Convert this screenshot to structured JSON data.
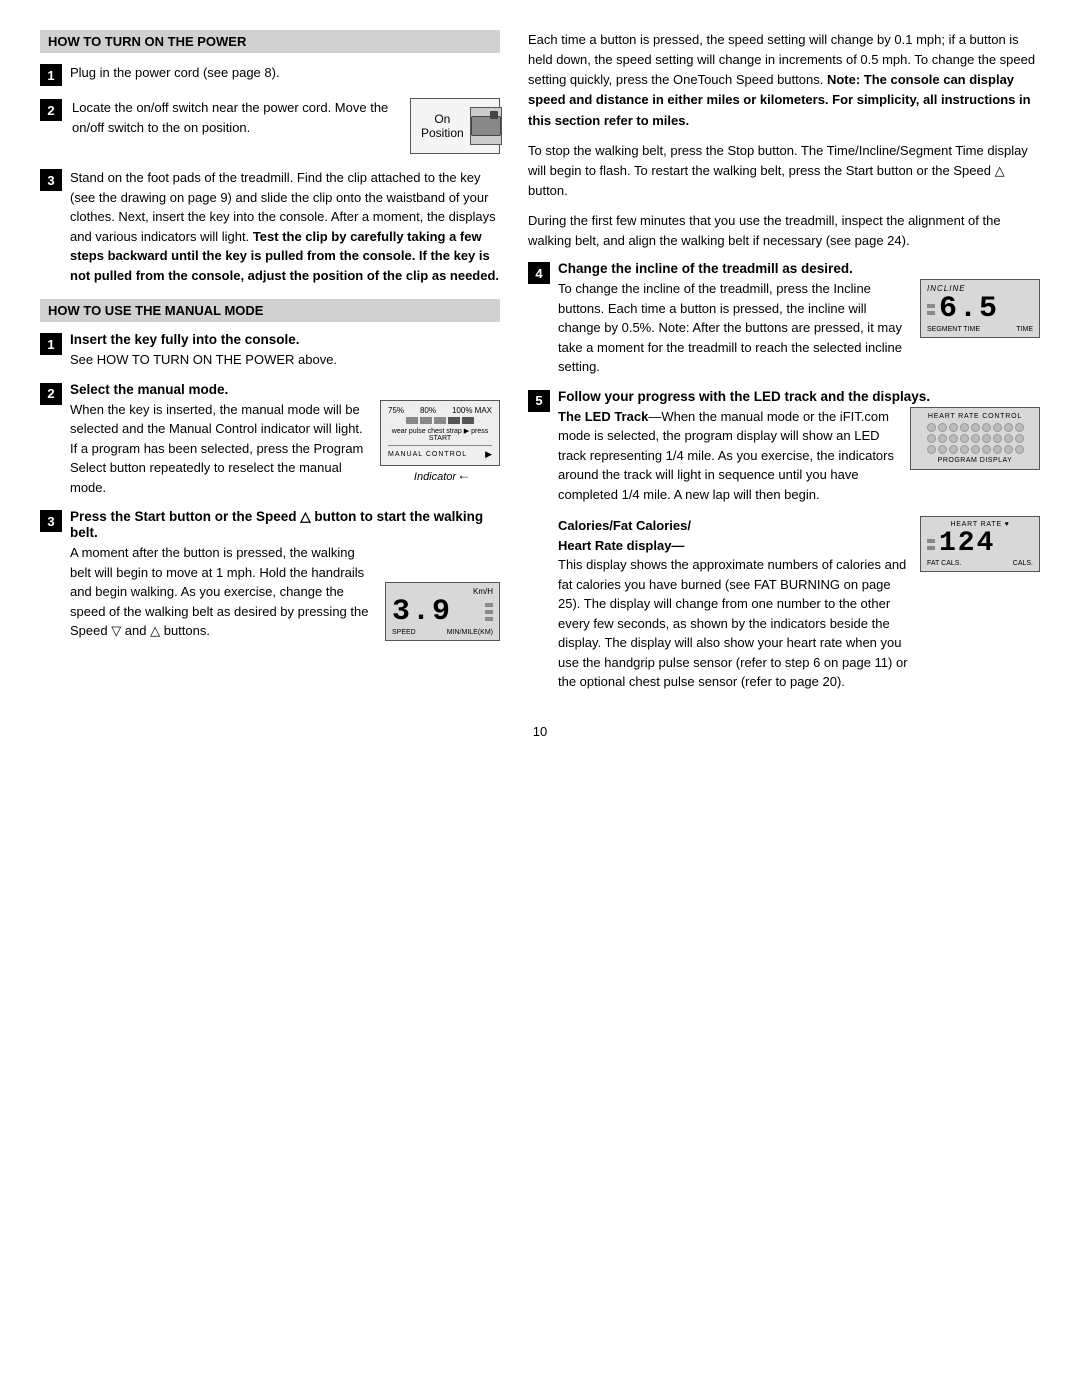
{
  "left": {
    "section1_header": "HOW TO TURN ON THE POWER",
    "step1_title": "Plug in the power cord (see page 8).",
    "step2_title": "Locate the on/off switch near the power cord. Move the on/off switch to the on position.",
    "on_position_label": "On\nPosition",
    "step3_text": "Stand on the foot pads of the treadmill. Find the clip attached to the key (see the drawing on page 9) and slide the clip onto the waistband of your clothes. Next, insert the key into the console. After a moment, the displays and various indicators will light.",
    "step3_bold": "Test the clip by carefully taking a few steps backward until the key is pulled from the console. If the key is not pulled from the console, adjust the position of the clip as needed.",
    "section2_header": "HOW TO USE THE MANUAL MODE",
    "manual_step1_title": "Insert the key fully into the console.",
    "manual_step1_text": "See HOW TO TURN ON THE POWER above.",
    "manual_step2_title": "Select the manual mode.",
    "manual_step2_text1": "When the key is inserted, the manual mode will be selected and the Manual Control indicator will light. If a program has been selected, press the Program Select button repeatedly to reselect the manual mode.",
    "manual_control_label": "MANUAL CONTROL",
    "indicator_label": "Indicator",
    "manual_step3_title": "Press the Start button or the Speed △ button to start the walking belt.",
    "manual_step3_text1": "A moment after the button is pressed, the walking belt will begin to move at 1 mph. Hold the handrails and begin walking. As you exercise, change the speed of the walking belt as desired by pressing the Speed ▽ and △ buttons.",
    "speed_display_value": "3.9",
    "speed_display_kmh": "Km/H",
    "speed_display_speed": "SPEED",
    "speed_display_min": "MIN/MILE(km)",
    "speed_change_note": "Each time a button is pressed, the speed setting will change by 0.1 mph; if a button is held down, the speed setting will change in increments of 0.5 mph. To change the speed setting quickly, press the OneTouch Speed buttons.",
    "speed_note_bold": "Note: The console can display speed and distance in either miles or kilometers. For simplicity, all instructions in this section refer to miles."
  },
  "right": {
    "para1": "Each time a button is pressed, the speed setting will change by 0.1 mph; if a button is held down, the speed setting will change in increments of 0.5 mph. To change the speed setting quickly, press the OneTouch Speed buttons.",
    "para1_bold_prefix": "Note: The console can display speed and distance in either miles or kilometers. For simplicity, all instructions in this section refer to miles.",
    "para2": "To stop the walking belt, press the Stop button. The Time/Incline/Segment Time display will begin to flash. To restart the walking belt, press the Start button or the Speed △ button.",
    "para3": "During the first few minutes that you use the treadmill, inspect the alignment of the walking belt, and align the walking belt if necessary (see page 24).",
    "step4_title": "Change the incline of the treadmill as desired.",
    "step4_text": "To change the incline of the treadmill, press the Incline buttons. Each time a button is pressed, the incline will change by 0.5%. Note: After the buttons are pressed, it may take a moment for the treadmill to reach the selected incline setting.",
    "incline_label": "INCLINE",
    "incline_value": "6.5",
    "incline_seg_label": "SEGMENT TIME",
    "incline_time_label": "TIME",
    "step5_title": "Follow your progress with the LED track and the displays.",
    "led_track_title": "The LED Track",
    "led_track_text": "—When the manual mode or the iFIT.com mode is selected, the program display will show an LED track representing 1/4 mile. As you exercise, the indicators around the track will light in sequence until you have completed 1/4 mile. A new lap will then begin.",
    "heart_rate_title": "HEART RATE CONTROL",
    "program_display_title": "PROGRAM DISPLAY",
    "calories_title": "Calories/Fat Calories/\nHeart Rate display—",
    "calories_text": "This display shows the approximate numbers of calories and fat calories you have burned (see FAT BURNING on page 25). The display will change from one number to the other every few seconds, as shown by the indicators beside the display. The display will also show your heart rate when you use the handgrip pulse sensor (refer to step 6 on page 11) or the optional chest pulse sensor (refer to page 20).",
    "hr_display_title": "HEART RATE",
    "hr_display_value": "124",
    "hr_fat_label": "FAT CALS.",
    "hr_cal_label": "CALS."
  },
  "page_number": "10"
}
